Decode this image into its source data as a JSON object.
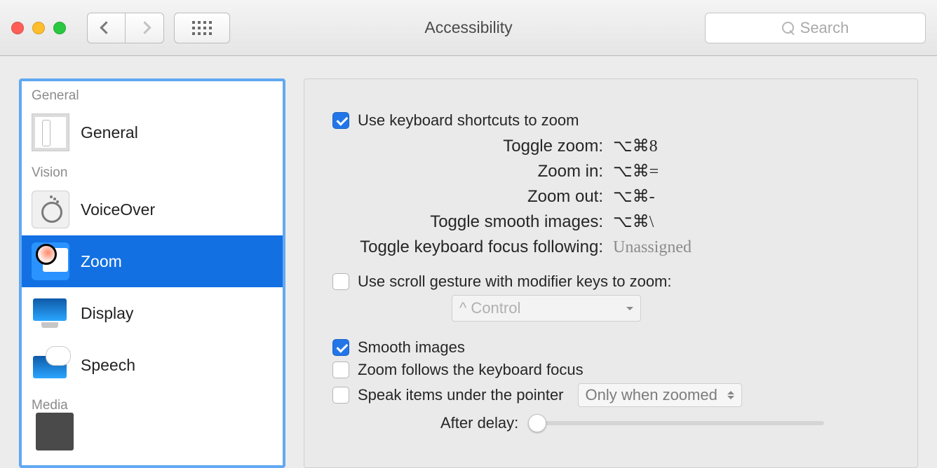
{
  "window": {
    "title": "Accessibility"
  },
  "toolbar": {
    "search_placeholder": "Search"
  },
  "sidebar": {
    "sections": {
      "general": "General",
      "vision": "Vision",
      "media": "Media"
    },
    "items": {
      "general": "General",
      "voiceover": "VoiceOver",
      "zoom": "Zoom",
      "display": "Display",
      "speech": "Speech"
    }
  },
  "pane": {
    "use_keyboard_shortcuts": "Use keyboard shortcuts to zoom",
    "shortcuts": {
      "toggle_zoom_label": "Toggle zoom:",
      "toggle_zoom_value": "⌥⌘8",
      "zoom_in_label": "Zoom in:",
      "zoom_in_value": "⌥⌘=",
      "zoom_out_label": "Zoom out:",
      "zoom_out_value": "⌥⌘-",
      "toggle_smooth_label": "Toggle smooth images:",
      "toggle_smooth_value": "⌥⌘\\",
      "toggle_focus_label": "Toggle keyboard focus following:",
      "toggle_focus_value": "Unassigned"
    },
    "use_scroll_gesture": "Use scroll gesture with modifier keys to zoom:",
    "modifier_dropdown": "^ Control",
    "smooth_images": "Smooth images",
    "zoom_follows_focus": "Zoom follows the keyboard focus",
    "speak_items": "Speak items under the pointer",
    "speak_mode": "Only when zoomed",
    "after_delay": "After delay:"
  }
}
